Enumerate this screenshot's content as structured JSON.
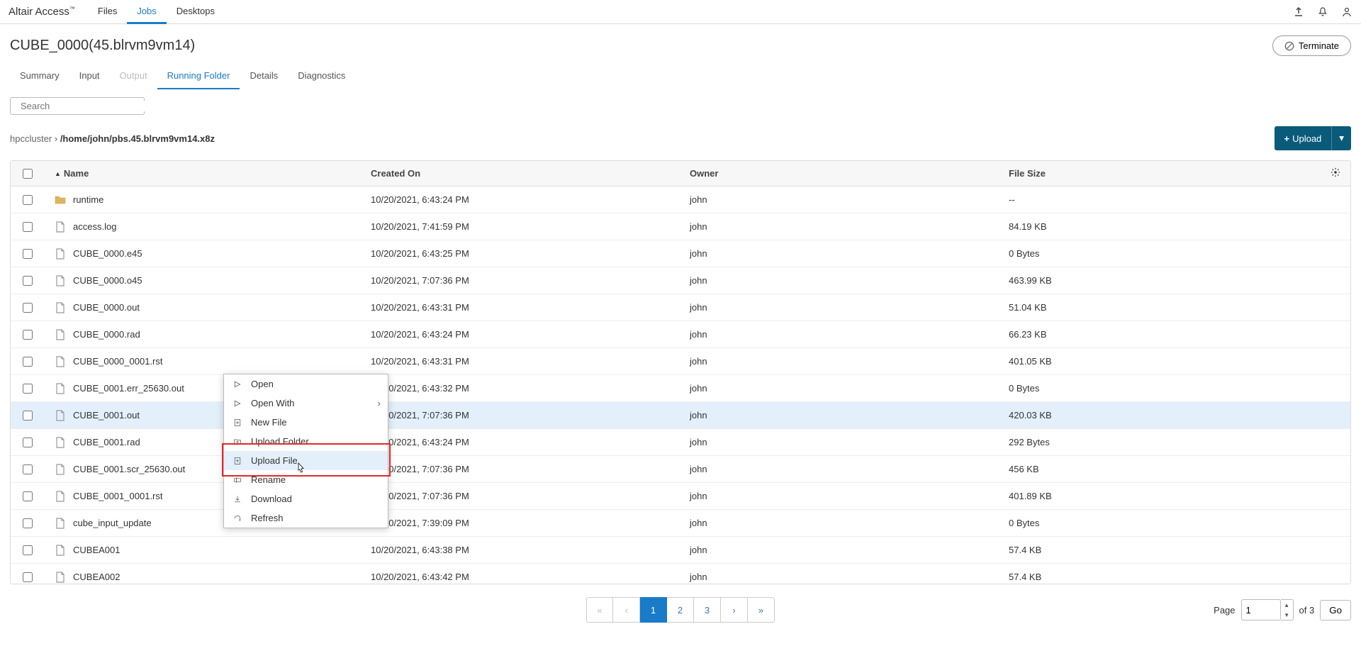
{
  "brand": "Altair Access",
  "topnav": [
    "Files",
    "Jobs",
    "Desktops"
  ],
  "topnav_active": 1,
  "page_title": "CUBE_0000(45.blrvm9vm14)",
  "terminate_label": "Terminate",
  "tabs": [
    "Summary",
    "Input",
    "Output",
    "Running Folder",
    "Details",
    "Diagnostics"
  ],
  "tabs_active": 3,
  "tabs_disabled": [
    2
  ],
  "search_placeholder": "Search",
  "breadcrumb": {
    "cluster": "hpccluster",
    "path": "/home/john/pbs.45.blrvm9vm14.x8z"
  },
  "upload_label": "Upload",
  "table": {
    "headers": {
      "name": "Name",
      "created": "Created On",
      "owner": "Owner",
      "size": "File Size"
    },
    "rows": [
      {
        "type": "folder",
        "name": "runtime",
        "created": "10/20/2021, 6:43:24 PM",
        "owner": "john",
        "size": "--"
      },
      {
        "type": "file",
        "name": "access.log",
        "created": "10/20/2021, 7:41:59 PM",
        "owner": "john",
        "size": "84.19 KB"
      },
      {
        "type": "file",
        "name": "CUBE_0000.e45",
        "created": "10/20/2021, 6:43:25 PM",
        "owner": "john",
        "size": "0 Bytes"
      },
      {
        "type": "file",
        "name": "CUBE_0000.o45",
        "created": "10/20/2021, 7:07:36 PM",
        "owner": "john",
        "size": "463.99 KB"
      },
      {
        "type": "file",
        "name": "CUBE_0000.out",
        "created": "10/20/2021, 6:43:31 PM",
        "owner": "john",
        "size": "51.04 KB"
      },
      {
        "type": "file",
        "name": "CUBE_0000.rad",
        "created": "10/20/2021, 6:43:24 PM",
        "owner": "john",
        "size": "66.23 KB"
      },
      {
        "type": "file",
        "name": "CUBE_0000_0001.rst",
        "created": "10/20/2021, 6:43:31 PM",
        "owner": "john",
        "size": "401.05 KB"
      },
      {
        "type": "file",
        "name": "CUBE_0001.err_25630.out",
        "created": "10/20/2021, 6:43:32 PM",
        "owner": "john",
        "size": "0 Bytes"
      },
      {
        "type": "file",
        "name": "CUBE_0001.out",
        "created": "10/20/2021, 7:07:36 PM",
        "owner": "john",
        "size": "420.03 KB",
        "selected": true
      },
      {
        "type": "file",
        "name": "CUBE_0001.rad",
        "created": "10/20/2021, 6:43:24 PM",
        "owner": "john",
        "size": "292 Bytes"
      },
      {
        "type": "file",
        "name": "CUBE_0001.scr_25630.out",
        "created": "10/20/2021, 7:07:36 PM",
        "owner": "john",
        "size": "456 KB"
      },
      {
        "type": "file",
        "name": "CUBE_0001_0001.rst",
        "created": "10/20/2021, 7:07:36 PM",
        "owner": "john",
        "size": "401.89 KB"
      },
      {
        "type": "file",
        "name": "cube_input_update",
        "created": "10/20/2021, 7:39:09 PM",
        "owner": "john",
        "size": "0 Bytes"
      },
      {
        "type": "file",
        "name": "CUBEA001",
        "created": "10/20/2021, 6:43:38 PM",
        "owner": "john",
        "size": "57.4 KB"
      },
      {
        "type": "file",
        "name": "CUBEA002",
        "created": "10/20/2021, 6:43:42 PM",
        "owner": "john",
        "size": "57.4 KB"
      }
    ]
  },
  "context_menu": {
    "items": [
      {
        "icon": "open",
        "label": "Open"
      },
      {
        "icon": "openwith",
        "label": "Open With",
        "submenu": true
      },
      {
        "icon": "newfile",
        "label": "New File"
      },
      {
        "icon": "upfolder",
        "label": "Upload Folder"
      },
      {
        "icon": "upfile",
        "label": "Upload File",
        "hover": true
      },
      {
        "icon": "rename",
        "label": "Rename"
      },
      {
        "icon": "download",
        "label": "Download"
      },
      {
        "icon": "refresh",
        "label": "Refresh"
      }
    ]
  },
  "pager": {
    "pages": [
      "«",
      "‹",
      "1",
      "2",
      "3",
      "›",
      "»"
    ],
    "active": 2,
    "disabled": [
      0,
      1
    ],
    "page_label": "Page",
    "page_value": "1",
    "of_label": "of 3",
    "go_label": "Go"
  }
}
